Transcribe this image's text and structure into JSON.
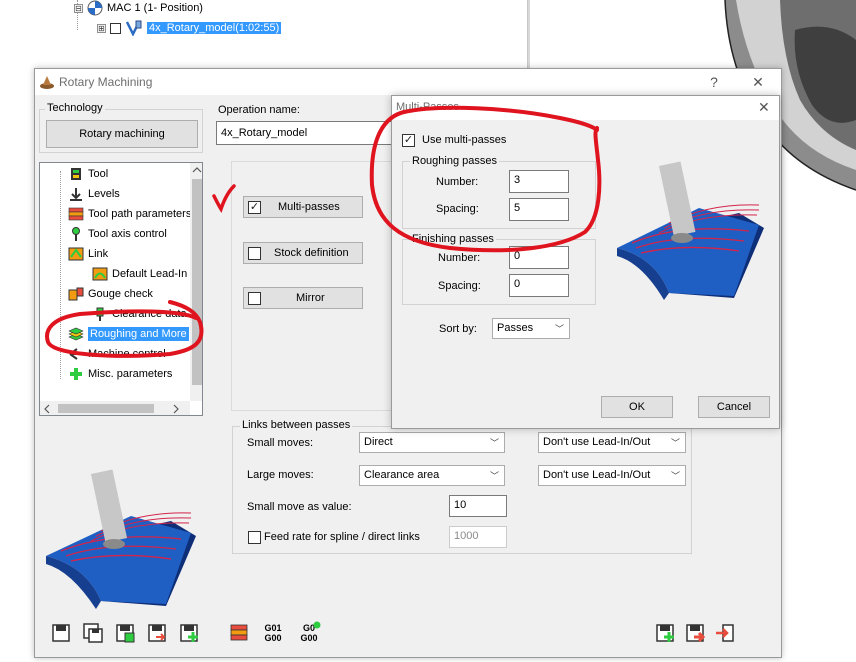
{
  "background": {
    "tree": [
      {
        "label": "MAC 1 (1- Position)",
        "expander": "⊟"
      },
      {
        "label": "4x_Rotary_model(1:02:55)",
        "expander": "⊞",
        "selected": true
      }
    ]
  },
  "main_dialog": {
    "title": "Rotary Machining",
    "help_label": "?",
    "close_label": "✕",
    "technology_label": "Technology",
    "technology_button": "Rotary machining",
    "operation_name_label": "Operation name:",
    "operation_name_value": "4x_Rotary_model",
    "tree_items": [
      {
        "label": "Tool",
        "icon": "tool-icon"
      },
      {
        "label": "Levels",
        "icon": "levels-icon"
      },
      {
        "label": "Tool path parameters",
        "icon": "toolpath-icon"
      },
      {
        "label": "Tool axis control",
        "icon": "tool-axis-icon"
      },
      {
        "label": "Link",
        "icon": "link-icon"
      },
      {
        "label": "Default Lead-In",
        "icon": "lead-in-icon"
      },
      {
        "label": "Gouge check",
        "icon": "gouge-icon"
      },
      {
        "label": "Clearance data",
        "icon": "clearance-icon"
      },
      {
        "label": "Roughing and More",
        "icon": "roughing-icon",
        "selected": true
      },
      {
        "label": "Machine control",
        "icon": "machine-control-icon"
      },
      {
        "label": "Misc. parameters",
        "icon": "misc-icon"
      }
    ],
    "options": [
      {
        "label": "Multi-passes",
        "checked": true
      },
      {
        "label": "Stock definition",
        "checked": false
      },
      {
        "label": "Mirror",
        "checked": false
      }
    ],
    "links_between_passes": {
      "title": "Links between passes",
      "small_moves_label": "Small moves:",
      "small_moves_value": "Direct",
      "small_moves_lead": "Don't use Lead-In/Out",
      "large_moves_label": "Large moves:",
      "large_moves_value": "Clearance area",
      "large_moves_lead": "Don't use Lead-In/Out",
      "small_move_value_label": "Small move as value:",
      "small_move_value": "10",
      "feed_rate_label": "Feed rate for spline / direct links",
      "feed_rate_checked": false,
      "feed_rate_value": "1000"
    },
    "toolbar": {
      "gcode_g01_top": "G01",
      "gcode_g01_bottom": "G00",
      "gcode_g0_top": "G0",
      "gcode_g0_bottom": "G00"
    }
  },
  "multi_passes_dialog": {
    "title": "Multi-Passes",
    "close_label": "✕",
    "use_multi_label": "Use multi-passes",
    "use_multi_checked": true,
    "roughing_title": "Roughing passes",
    "roughing_number_label": "Number:",
    "roughing_number_value": "3",
    "roughing_spacing_label": "Spacing:",
    "roughing_spacing_value": "5",
    "finishing_title": "Finishing passes",
    "finishing_number_label": "Number:",
    "finishing_number_value": "0",
    "finishing_spacing_label": "Spacing:",
    "finishing_spacing_value": "0",
    "sort_by_label": "Sort by:",
    "sort_by_value": "Passes",
    "ok_label": "OK",
    "cancel_label": "Cancel"
  },
  "colors": {
    "selection": "#3399ff",
    "annotation_red": "#e0141e",
    "model_blue": "#1f5fc4"
  }
}
